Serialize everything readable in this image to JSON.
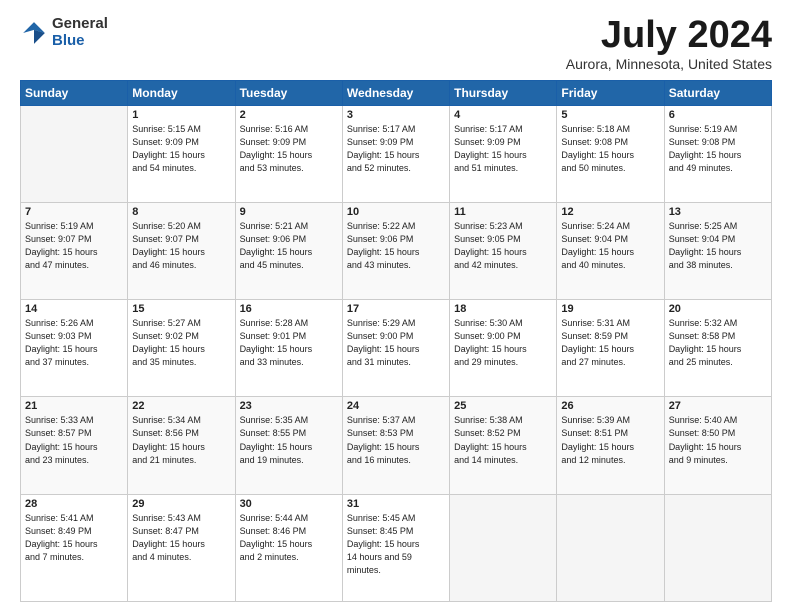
{
  "logo": {
    "general": "General",
    "blue": "Blue"
  },
  "header": {
    "month": "July 2024",
    "location": "Aurora, Minnesota, United States"
  },
  "weekdays": [
    "Sunday",
    "Monday",
    "Tuesday",
    "Wednesday",
    "Thursday",
    "Friday",
    "Saturday"
  ],
  "weeks": [
    [
      {
        "day": "",
        "empty": true
      },
      {
        "day": "1",
        "sunrise": "5:15 AM",
        "sunset": "9:09 PM",
        "daylight": "15 hours and 54 minutes."
      },
      {
        "day": "2",
        "sunrise": "5:16 AM",
        "sunset": "9:09 PM",
        "daylight": "15 hours and 53 minutes."
      },
      {
        "day": "3",
        "sunrise": "5:17 AM",
        "sunset": "9:09 PM",
        "daylight": "15 hours and 52 minutes."
      },
      {
        "day": "4",
        "sunrise": "5:17 AM",
        "sunset": "9:09 PM",
        "daylight": "15 hours and 51 minutes."
      },
      {
        "day": "5",
        "sunrise": "5:18 AM",
        "sunset": "9:08 PM",
        "daylight": "15 hours and 50 minutes."
      },
      {
        "day": "6",
        "sunrise": "5:19 AM",
        "sunset": "9:08 PM",
        "daylight": "15 hours and 49 minutes."
      }
    ],
    [
      {
        "day": "7",
        "sunrise": "5:19 AM",
        "sunset": "9:07 PM",
        "daylight": "15 hours and 47 minutes."
      },
      {
        "day": "8",
        "sunrise": "5:20 AM",
        "sunset": "9:07 PM",
        "daylight": "15 hours and 46 minutes."
      },
      {
        "day": "9",
        "sunrise": "5:21 AM",
        "sunset": "9:06 PM",
        "daylight": "15 hours and 45 minutes."
      },
      {
        "day": "10",
        "sunrise": "5:22 AM",
        "sunset": "9:06 PM",
        "daylight": "15 hours and 43 minutes."
      },
      {
        "day": "11",
        "sunrise": "5:23 AM",
        "sunset": "9:05 PM",
        "daylight": "15 hours and 42 minutes."
      },
      {
        "day": "12",
        "sunrise": "5:24 AM",
        "sunset": "9:04 PM",
        "daylight": "15 hours and 40 minutes."
      },
      {
        "day": "13",
        "sunrise": "5:25 AM",
        "sunset": "9:04 PM",
        "daylight": "15 hours and 38 minutes."
      }
    ],
    [
      {
        "day": "14",
        "sunrise": "5:26 AM",
        "sunset": "9:03 PM",
        "daylight": "15 hours and 37 minutes."
      },
      {
        "day": "15",
        "sunrise": "5:27 AM",
        "sunset": "9:02 PM",
        "daylight": "15 hours and 35 minutes."
      },
      {
        "day": "16",
        "sunrise": "5:28 AM",
        "sunset": "9:01 PM",
        "daylight": "15 hours and 33 minutes."
      },
      {
        "day": "17",
        "sunrise": "5:29 AM",
        "sunset": "9:00 PM",
        "daylight": "15 hours and 31 minutes."
      },
      {
        "day": "18",
        "sunrise": "5:30 AM",
        "sunset": "9:00 PM",
        "daylight": "15 hours and 29 minutes."
      },
      {
        "day": "19",
        "sunrise": "5:31 AM",
        "sunset": "8:59 PM",
        "daylight": "15 hours and 27 minutes."
      },
      {
        "day": "20",
        "sunrise": "5:32 AM",
        "sunset": "8:58 PM",
        "daylight": "15 hours and 25 minutes."
      }
    ],
    [
      {
        "day": "21",
        "sunrise": "5:33 AM",
        "sunset": "8:57 PM",
        "daylight": "15 hours and 23 minutes."
      },
      {
        "day": "22",
        "sunrise": "5:34 AM",
        "sunset": "8:56 PM",
        "daylight": "15 hours and 21 minutes."
      },
      {
        "day": "23",
        "sunrise": "5:35 AM",
        "sunset": "8:55 PM",
        "daylight": "15 hours and 19 minutes."
      },
      {
        "day": "24",
        "sunrise": "5:37 AM",
        "sunset": "8:53 PM",
        "daylight": "15 hours and 16 minutes."
      },
      {
        "day": "25",
        "sunrise": "5:38 AM",
        "sunset": "8:52 PM",
        "daylight": "15 hours and 14 minutes."
      },
      {
        "day": "26",
        "sunrise": "5:39 AM",
        "sunset": "8:51 PM",
        "daylight": "15 hours and 12 minutes."
      },
      {
        "day": "27",
        "sunrise": "5:40 AM",
        "sunset": "8:50 PM",
        "daylight": "15 hours and 9 minutes."
      }
    ],
    [
      {
        "day": "28",
        "sunrise": "5:41 AM",
        "sunset": "8:49 PM",
        "daylight": "15 hours and 7 minutes."
      },
      {
        "day": "29",
        "sunrise": "5:43 AM",
        "sunset": "8:47 PM",
        "daylight": "15 hours and 4 minutes."
      },
      {
        "day": "30",
        "sunrise": "5:44 AM",
        "sunset": "8:46 PM",
        "daylight": "15 hours and 2 minutes."
      },
      {
        "day": "31",
        "sunrise": "5:45 AM",
        "sunset": "8:45 PM",
        "daylight": "14 hours and 59 minutes."
      },
      {
        "day": "",
        "empty": true
      },
      {
        "day": "",
        "empty": true
      },
      {
        "day": "",
        "empty": true
      }
    ]
  ]
}
